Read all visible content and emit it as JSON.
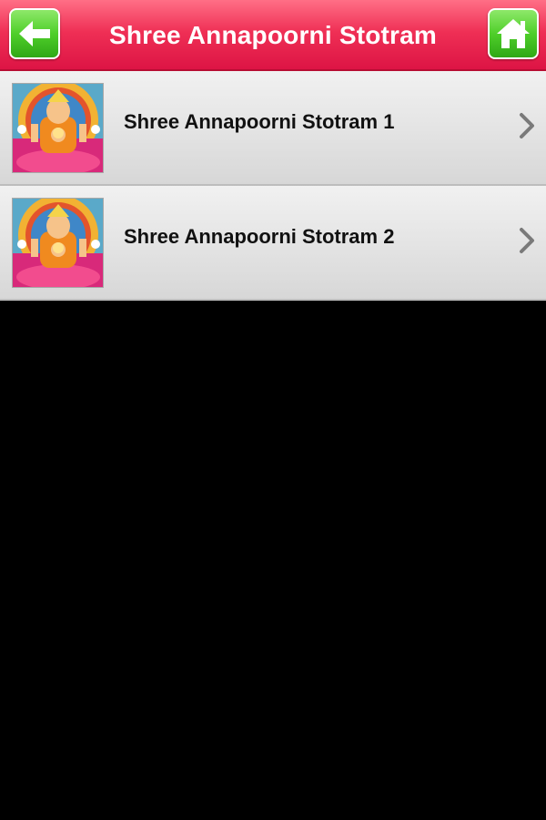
{
  "header": {
    "title": "Shree Annapoorni Stotram",
    "back_icon": "arrow-left-icon",
    "home_icon": "home-icon",
    "bar_color": "#e41b4a",
    "button_color": "#46c62a"
  },
  "list": {
    "items": [
      {
        "label": "Shree Annapoorni Stotram 1",
        "thumb": "annapoorni-image",
        "trailing_icon": "chevron-right-icon"
      },
      {
        "label": "Shree Annapoorni Stotram 2",
        "thumb": "annapoorni-image",
        "trailing_icon": "chevron-right-icon"
      }
    ]
  }
}
